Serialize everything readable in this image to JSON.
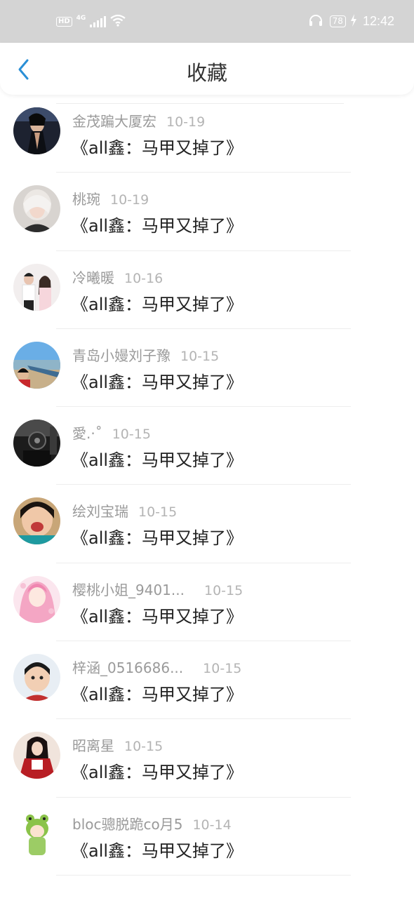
{
  "status_bar": {
    "hd": "HD",
    "network": "4G",
    "battery": "78",
    "time": "12:42"
  },
  "header": {
    "title": "收藏",
    "back_icon": "chevron-left-icon",
    "accent_color": "#2a8fd6"
  },
  "favorites": [
    {
      "user": "金茂蹁大厦宏",
      "date": "10-19",
      "title": "《all鑫：马甲又掉了》",
      "avatar": "dark-figure"
    },
    {
      "user": "桃琬",
      "date": "10-19",
      "title": "《all鑫：马甲又掉了》",
      "avatar": "white-hair-person"
    },
    {
      "user": "冷曦暖",
      "date": "10-16",
      "title": "《all鑫：马甲又掉了》",
      "avatar": "couple"
    },
    {
      "user": "青岛小嫚刘子豫",
      "date": "10-15",
      "title": "《all鑫：马甲又掉了》",
      "avatar": "seaside"
    },
    {
      "user": "愛.·˚",
      "date": "10-15",
      "title": "《all鑫：马甲又掉了》",
      "avatar": "dark-room"
    },
    {
      "user": "绘刘宝瑞",
      "date": "10-15",
      "title": "《all鑫：马甲又掉了》",
      "avatar": "laughing-child"
    },
    {
      "user": "樱桃小姐_9401...",
      "date": "10-15",
      "title": "《all鑫：马甲又掉了》",
      "avatar": "pink-anime-girl"
    },
    {
      "user": "梓涵_0516686...",
      "date": "10-15",
      "title": "《all鑫：马甲又掉了》",
      "avatar": "boy"
    },
    {
      "user": "昭离星",
      "date": "10-15",
      "title": "《all鑫：马甲又掉了》",
      "avatar": "red-costume"
    },
    {
      "user": "bloc骢脱跪co月5",
      "date": "10-14",
      "title": "《all鑫：马甲又掉了》",
      "avatar": "frog-hood-cartoon"
    }
  ]
}
